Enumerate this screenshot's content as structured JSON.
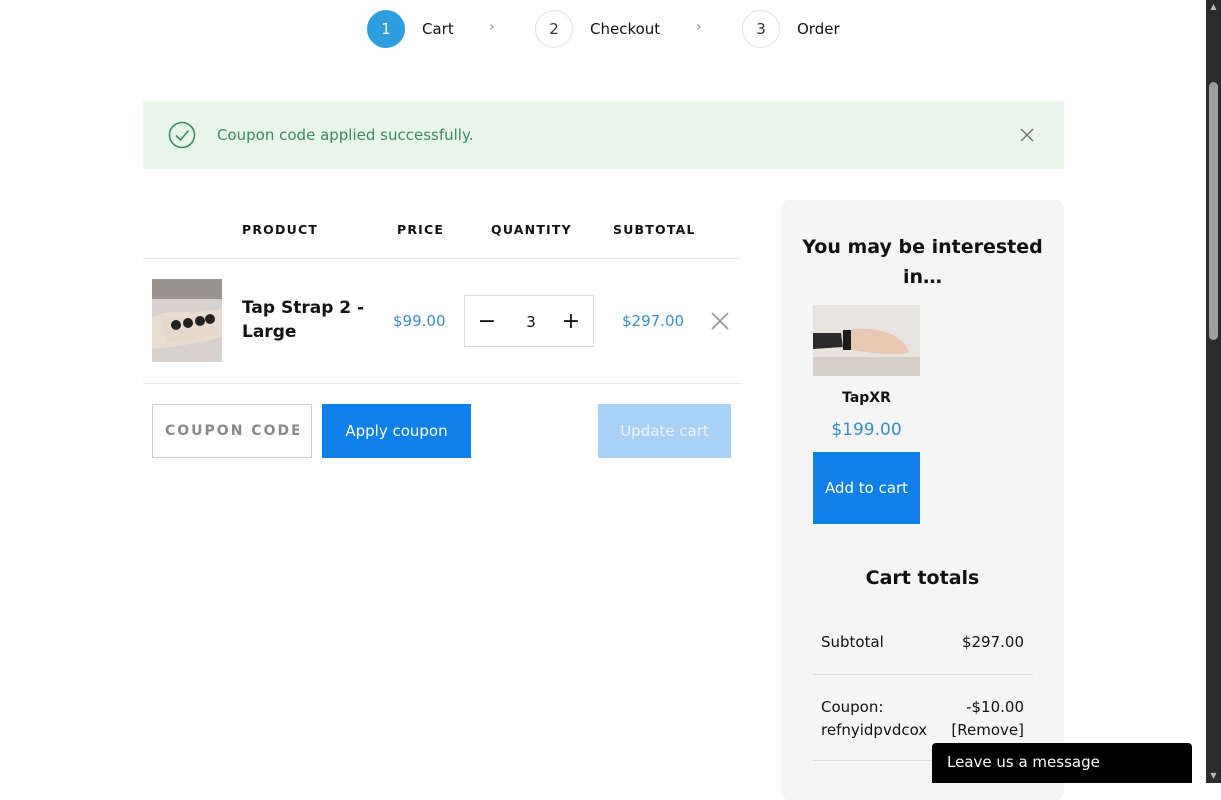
{
  "steps": [
    {
      "number": "1",
      "label": "Cart"
    },
    {
      "number": "2",
      "label": "Checkout"
    },
    {
      "number": "3",
      "label": "Order"
    }
  ],
  "step_separator": "›",
  "notice": {
    "text": "Coupon code applied successfully."
  },
  "cart_table": {
    "headers": {
      "product": "PRODUCT",
      "price": "PRICE",
      "quantity": "QUANTITY",
      "subtotal": "SUBTOTAL"
    },
    "items": [
      {
        "name": "Tap Strap 2 - Large",
        "price": "$99.00",
        "quantity": "3",
        "subtotal": "$297.00"
      }
    ]
  },
  "qty_controls": {
    "minus": "−",
    "plus": "+"
  },
  "coupon": {
    "placeholder": "COUPON CODE",
    "apply_label": "Apply coupon"
  },
  "update_cart_label": "Update cart",
  "sidebar": {
    "title": "You may be interested in…",
    "product": {
      "name": "TapXR",
      "price": "$199.00",
      "add_label": "Add to cart"
    }
  },
  "totals": {
    "title": "Cart totals",
    "subtotal_label": "Subtotal",
    "subtotal_value": "$297.00",
    "coupon_label": "Coupon: refnyidpvdcox",
    "coupon_value": "-$10.00",
    "coupon_remove": "[Remove]"
  },
  "chat": {
    "label": "Leave us a message"
  },
  "colors": {
    "accent": "#2f9ee0",
    "button": "#0f7fea",
    "price": "#3a8ec4",
    "success_bg": "#e8f6ea",
    "success_text": "#3c8a5e"
  }
}
